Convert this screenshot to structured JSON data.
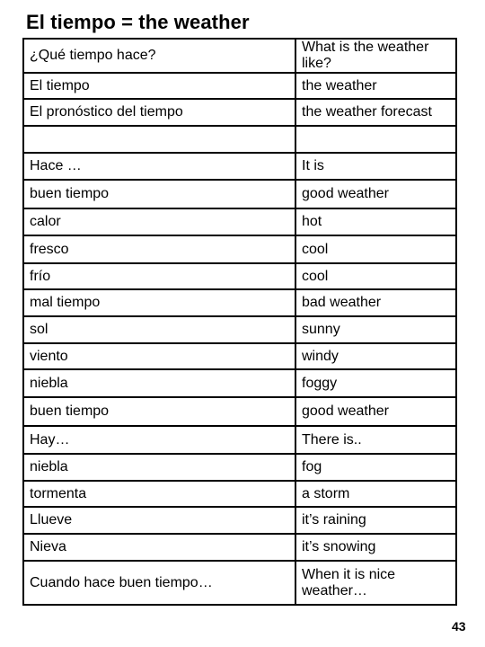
{
  "title": "El tiempo = the weather",
  "rows": [
    {
      "es": "¿Qué tiempo hace?",
      "en": "What is the weather like?"
    },
    {
      "es": "El tiempo",
      "en": "the weather"
    },
    {
      "es": "El pronóstico del tiempo",
      "en": "the weather forecast"
    },
    {
      "es": "",
      "en": ""
    },
    {
      "es": "Hace …",
      "en": "It is"
    },
    {
      "es": "buen tiempo",
      "en": "good weather"
    },
    {
      "es": "calor",
      "en": "hot"
    },
    {
      "es": "fresco",
      "en": "cool"
    },
    {
      "es": "frío",
      "en": "cool"
    },
    {
      "es": "mal tiempo",
      "en": "bad weather"
    },
    {
      "es": "sol",
      "en": "sunny"
    },
    {
      "es": "viento",
      "en": "windy"
    },
    {
      "es": "niebla",
      "en": "foggy"
    },
    {
      "es": "buen tiempo",
      "en": "good weather"
    },
    {
      "es": "Hay…",
      "en": "There is.."
    },
    {
      "es": "niebla",
      "en": "fog"
    },
    {
      "es": "tormenta",
      "en": "a storm"
    },
    {
      "es": "Llueve",
      "en": "it’s raining"
    },
    {
      "es": "Nieva",
      "en": "it’s snowing"
    },
    {
      "es": "Cuando hace buen tiempo…",
      "en": "When it is nice weather…"
    }
  ],
  "page_number": "43"
}
